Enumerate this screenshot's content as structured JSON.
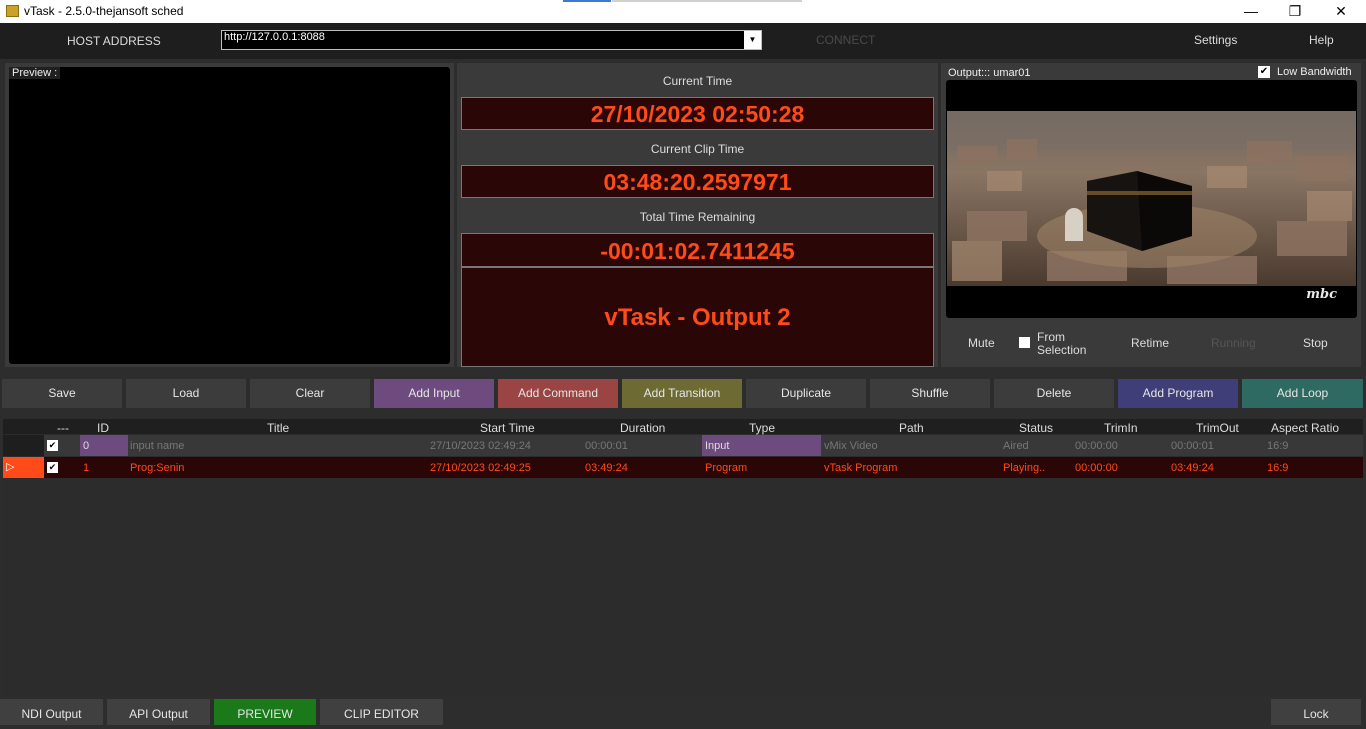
{
  "window": {
    "title": "vTask - 2.5.0-thejansoft sched",
    "minimize": "—",
    "restore": "❐",
    "close": "✕"
  },
  "header": {
    "host_label": "HOST ADDRESS",
    "host_value": "http://127.0.0.1:8088",
    "connect": "CONNECT",
    "settings": "Settings",
    "help": "Help"
  },
  "preview": {
    "label": "Preview :"
  },
  "time": {
    "current_time_label": "Current Time",
    "current_time": "27/10/2023 02:50:28",
    "clip_time_label": "Current Clip Time",
    "clip_time": "03:48:20.2597971",
    "remaining_label": "Total Time Remaining",
    "remaining": "-00:01:02.7411245",
    "output_name": "vTask - Output 2"
  },
  "output": {
    "label": "Output::: umar01",
    "low_bandwidth": "Low Bandwidth",
    "low_bandwidth_checked": true,
    "logo": "mbc",
    "mute": "Mute",
    "from_selection_1": "From",
    "from_selection_2": "Selection",
    "retime": "Retime",
    "running": "Running",
    "stop": "Stop"
  },
  "actions": {
    "save": "Save",
    "load": "Load",
    "clear": "Clear",
    "add_input": "Add Input",
    "add_command": "Add Command",
    "add_transition": "Add Transition",
    "duplicate": "Duplicate",
    "shuffle": "Shuffle",
    "delete": "Delete",
    "add_program": "Add Program",
    "add_loop": "Add Loop"
  },
  "colors": {
    "add_input": "#6e4b7e",
    "add_command": "#9a4444",
    "add_transition": "#6d6a34",
    "add_program": "#3f3e78",
    "add_loop": "#2f6a62",
    "digit": "#ff4a1a",
    "preview_tab": "#1a7a1a"
  },
  "grid": {
    "headers": [
      "---",
      "ID",
      "Title",
      "Start Time",
      "Duration",
      "Type",
      "Path",
      "Status",
      "TrimIn",
      "TrimOut",
      "Aspect Ratio"
    ],
    "rows": [
      {
        "id": "0",
        "title": "input name",
        "start": "27/10/2023 02:49:24",
        "duration": "00:00:01",
        "type": "Input",
        "path": "vMix Video",
        "status": "Aired",
        "trimin": "00:00:00",
        "trimout": "00:00:01",
        "aspect": "16:9"
      },
      {
        "id": "1",
        "title": "Prog:Senin",
        "start": "27/10/2023 02:49:25",
        "duration": "03:49:24",
        "type": "Program",
        "path": "vTask Program",
        "status": "Playing..",
        "trimin": "00:00:00",
        "trimout": "03:49:24",
        "aspect": "16:9"
      }
    ]
  },
  "tabs": {
    "ndi": "NDI Output",
    "api": "API Output",
    "preview": "PREVIEW",
    "clip_editor": "CLIP EDITOR",
    "lock": "Lock"
  }
}
